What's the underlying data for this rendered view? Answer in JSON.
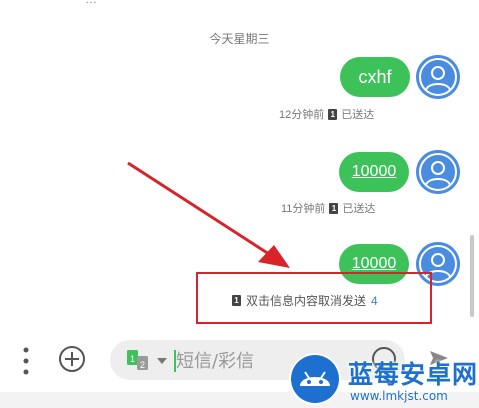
{
  "top_partial_text": "…",
  "date_separator": "今天星期三",
  "messages": [
    {
      "text": "cxhf",
      "time": "12分钟前",
      "sim": "1",
      "status": "已送达"
    },
    {
      "text": "10000",
      "time": "11分钟前",
      "sim": "1",
      "status": "已送达"
    },
    {
      "text": "10000",
      "sim": "1",
      "hint": "双击信息内容取消发送",
      "countdown": "4"
    }
  ],
  "composer": {
    "placeholder": "短信/彩信",
    "sim_badge": "1",
    "sim_badge_secondary": "2"
  },
  "bottom_partial_text": "...",
  "watermark": {
    "title": "蓝莓安卓网",
    "url": "www.lmkjst.com"
  },
  "colors": {
    "bubble_green": "#3dc25a",
    "annotation_red": "#d8232a",
    "avatar_blue": "#4a8de0",
    "countdown_blue": "#3b82d6",
    "watermark_blue": "#1d6fd0"
  },
  "icons": [
    "more-vertical-icon",
    "add-circle-icon",
    "sim-card-icon",
    "chevron-down-icon",
    "emoji-icon",
    "send-icon",
    "contact-avatar-icon"
  ]
}
